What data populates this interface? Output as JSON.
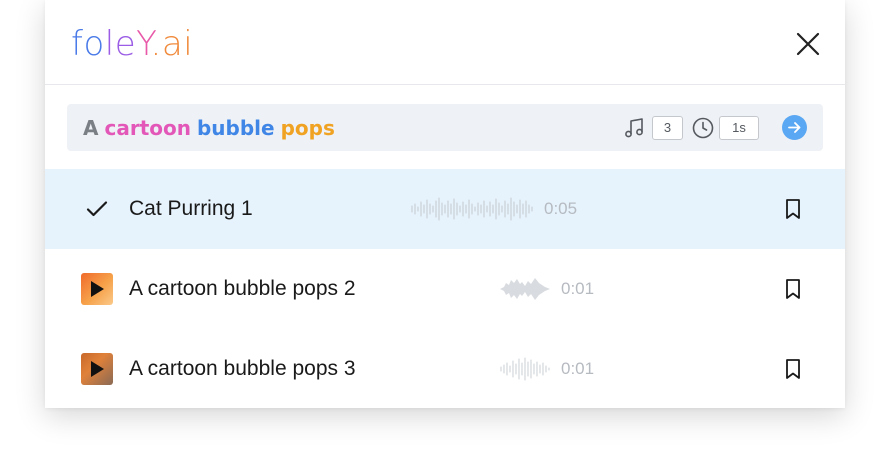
{
  "app": {
    "logo_parts": [
      "fo",
      "le",
      "Y",
      ".ai"
    ]
  },
  "search": {
    "query_words": [
      "A",
      "cartoon",
      "bubble",
      "pops"
    ],
    "variations": "3",
    "duration": "1s"
  },
  "results": [
    {
      "title": "Cat Purring 1",
      "duration": "0:05",
      "selected": true,
      "icon": "check-icon"
    },
    {
      "title": "A cartoon bubble pops 2",
      "duration": "0:01",
      "selected": false,
      "icon": "play-icon"
    },
    {
      "title": "A cartoon bubble pops 3",
      "duration": "0:01",
      "selected": false,
      "icon": "play-icon"
    }
  ],
  "colors": {
    "logo_blue": "#4b7be8",
    "logo_purple": "#9b5de5",
    "logo_pink": "#e85aa9",
    "logo_orange": "#f08a3c",
    "query_gray": "#7a7f86",
    "query_pink": "#e257b8",
    "query_blue": "#3f86e6",
    "query_gold": "#f0a222",
    "selected_row_bg": "#e6f2fc",
    "submit_button": "#5aa7f3"
  }
}
